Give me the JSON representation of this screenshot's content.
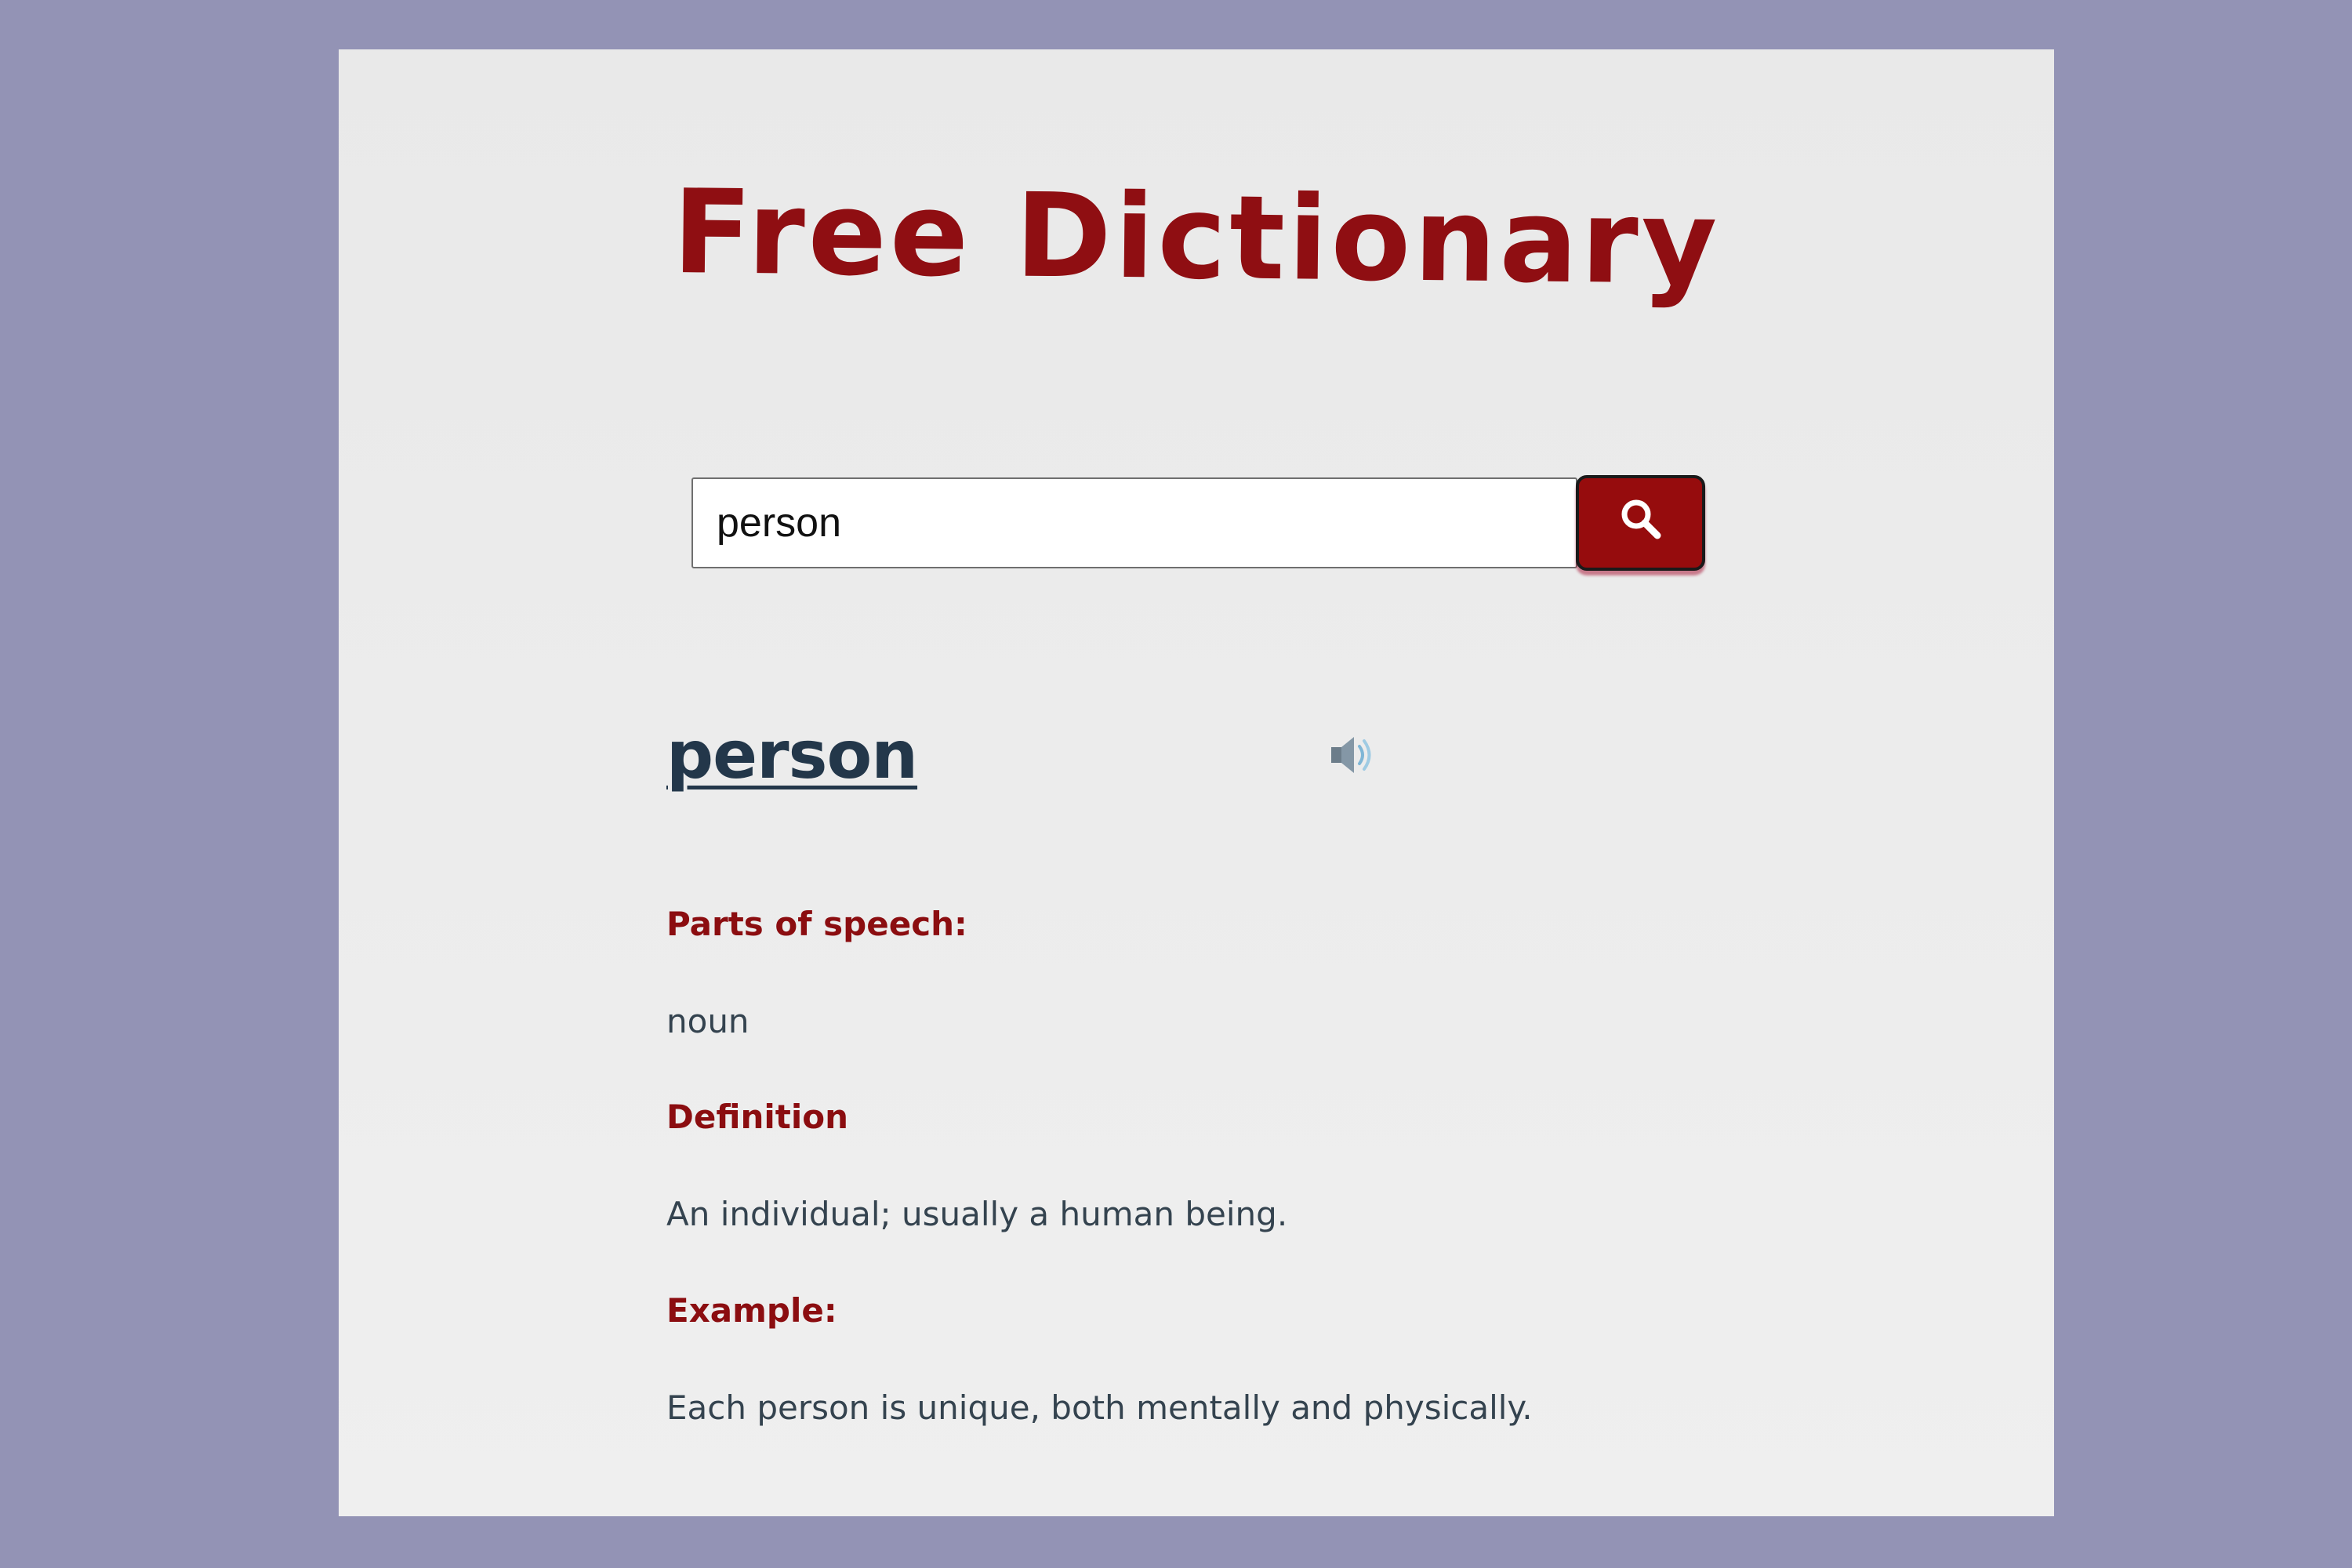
{
  "app": {
    "title": "Free Dictionary"
  },
  "search": {
    "value": "person",
    "button_icon": "search-icon"
  },
  "entry": {
    "word": "person",
    "audio_icon": "speaker-icon",
    "parts_of_speech_label": "Parts of speech:",
    "parts_of_speech": "noun",
    "definition_label": "Definition",
    "definition": "An individual; usually a human being.",
    "example_label": "Example:",
    "example": "Each person is unique, both mentally and physically."
  },
  "colors": {
    "page_background": "#9393b5",
    "card_background": "#ececec",
    "accent": "#8f0e12",
    "heading": "#23374a",
    "body_text": "#34434f"
  }
}
